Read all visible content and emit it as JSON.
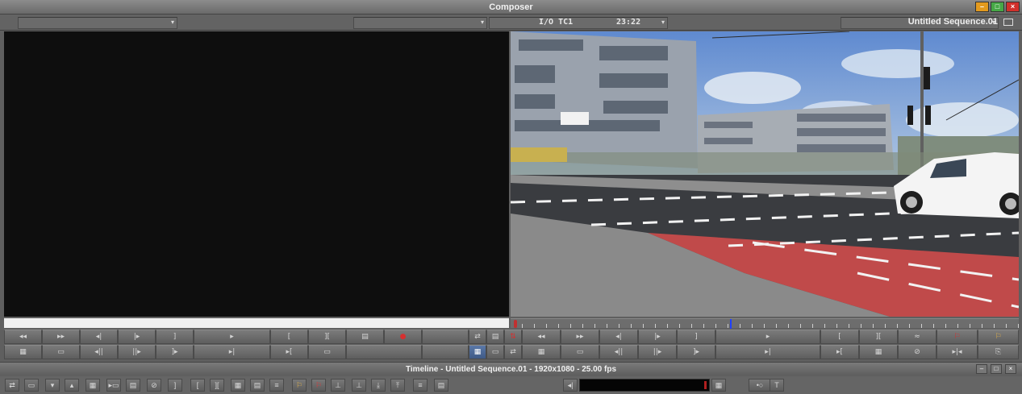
{
  "window": {
    "title": "Composer",
    "controls": [
      "–",
      "□",
      "×"
    ]
  },
  "header": {
    "source_dropdown_value": "",
    "mid_dropdown_value": "",
    "tc_label": "I/O TC1",
    "tc_value": "23:22",
    "sequence_name": "Untitled Sequence.01"
  },
  "source_buttons_row1": [
    "◂◂",
    "▸▸",
    "◂|",
    "|▸",
    "]",
    "▸",
    "[",
    "][",
    "▤",
    "●"
  ],
  "source_buttons_row2": [
    "▦",
    "▭",
    "◂||",
    "||▸",
    "]▸",
    "▸|",
    "▸[",
    "▭"
  ],
  "mid_buttons_row1": [
    "⇄",
    "▤",
    "⇅"
  ],
  "mid_buttons_row2": [
    "▦",
    "▭",
    "⇄"
  ],
  "record_buttons_row1": [
    "◂◂",
    "▸▸",
    "◂|",
    "|▸",
    "]",
    "▸",
    "[",
    "][",
    "≈",
    "⚐",
    "⚐"
  ],
  "record_buttons_row2": [
    "▦",
    "▭",
    "◂||",
    "||▸",
    "]▸",
    "▸|",
    "▸[",
    "▦",
    "⊘",
    "▸|◂",
    "⎘"
  ],
  "timeline": {
    "title": "Timeline - Untitled Sequence.01 - 1920x1080 - 25.00 fps",
    "controls": [
      "–",
      "□",
      "×"
    ]
  },
  "timeline_toolbar": [
    "⇄",
    "▭",
    "▾",
    "▴",
    "▦",
    "▸▭",
    "▤",
    "⊘",
    "]",
    "[",
    "][",
    "▦",
    "▤",
    "≡",
    "⚐",
    "⚐",
    "⊥",
    "⊥",
    "⤓",
    "⤒",
    "≡",
    "▤",
    "◂|",
    "▦",
    "•○",
    "T"
  ],
  "colors": {
    "window_bg": "#5f5f5f",
    "monitor_black": "#0e0e0e",
    "position_indicator": "#2040ff",
    "active_button": "#3f5a86"
  }
}
